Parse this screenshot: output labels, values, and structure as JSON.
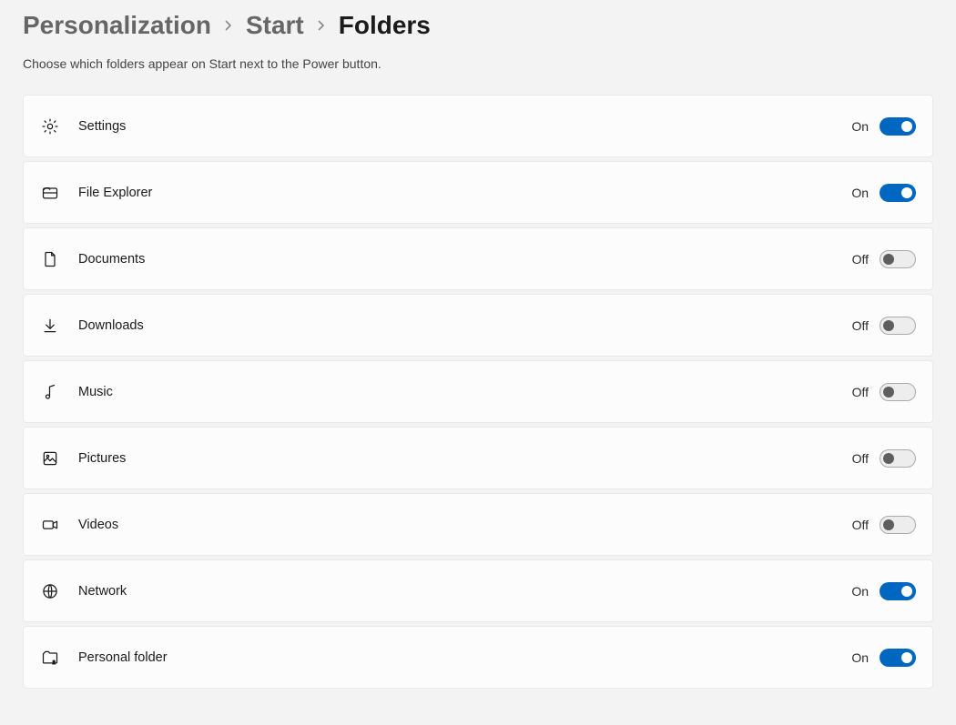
{
  "breadcrumb": {
    "items": [
      "Personalization",
      "Start",
      "Folders"
    ]
  },
  "subtitle": "Choose which folders appear on Start next to the Power button.",
  "labels": {
    "on": "On",
    "off": "Off"
  },
  "items": [
    {
      "id": "settings",
      "icon": "gear-icon",
      "label": "Settings",
      "value": true
    },
    {
      "id": "file-explorer",
      "icon": "file-explorer-icon",
      "label": "File Explorer",
      "value": true
    },
    {
      "id": "documents",
      "icon": "document-icon",
      "label": "Documents",
      "value": false
    },
    {
      "id": "downloads",
      "icon": "download-icon",
      "label": "Downloads",
      "value": false
    },
    {
      "id": "music",
      "icon": "music-icon",
      "label": "Music",
      "value": false
    },
    {
      "id": "pictures",
      "icon": "pictures-icon",
      "label": "Pictures",
      "value": false
    },
    {
      "id": "videos",
      "icon": "video-icon",
      "label": "Videos",
      "value": false
    },
    {
      "id": "network",
      "icon": "network-icon",
      "label": "Network",
      "value": true
    },
    {
      "id": "personal-folder",
      "icon": "personal-folder-icon",
      "label": "Personal folder",
      "value": true
    }
  ]
}
